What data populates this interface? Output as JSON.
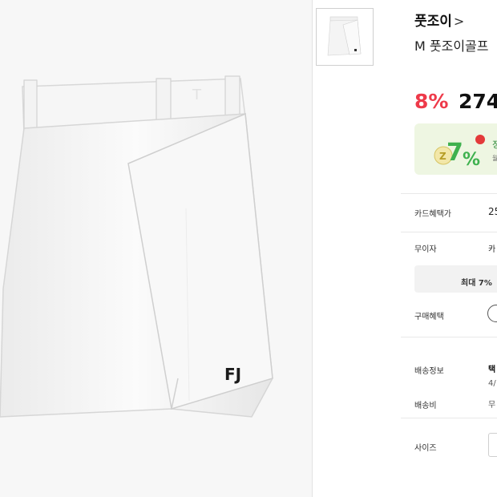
{
  "product": {
    "brand": "풋조이",
    "brand_chevron": ">",
    "title": "M 풋조이골프",
    "discount": "8%",
    "price": "274"
  },
  "banner": {
    "text1": "정",
    "text2": "월"
  },
  "rows": {
    "card_benefit_label": "카드혜택가",
    "card_benefit_value": "25",
    "interest_free_label": "무이자",
    "interest_free_value": "카",
    "max_text": "최대 7% ",
    "purchase_benefit_label": "구매혜택",
    "shipping_label": "배송정보",
    "shipping_value1": "택",
    "shipping_value2": "4/",
    "shipping_fee_label": "배송비",
    "shipping_fee_value": "무",
    "size_label": "사이즈"
  },
  "image": {
    "logo_text": "FJ"
  },
  "colors": {
    "discount": "#ee3a4a",
    "banner_bg": "#eef6e2",
    "banner_green": "#2e8a3d"
  }
}
